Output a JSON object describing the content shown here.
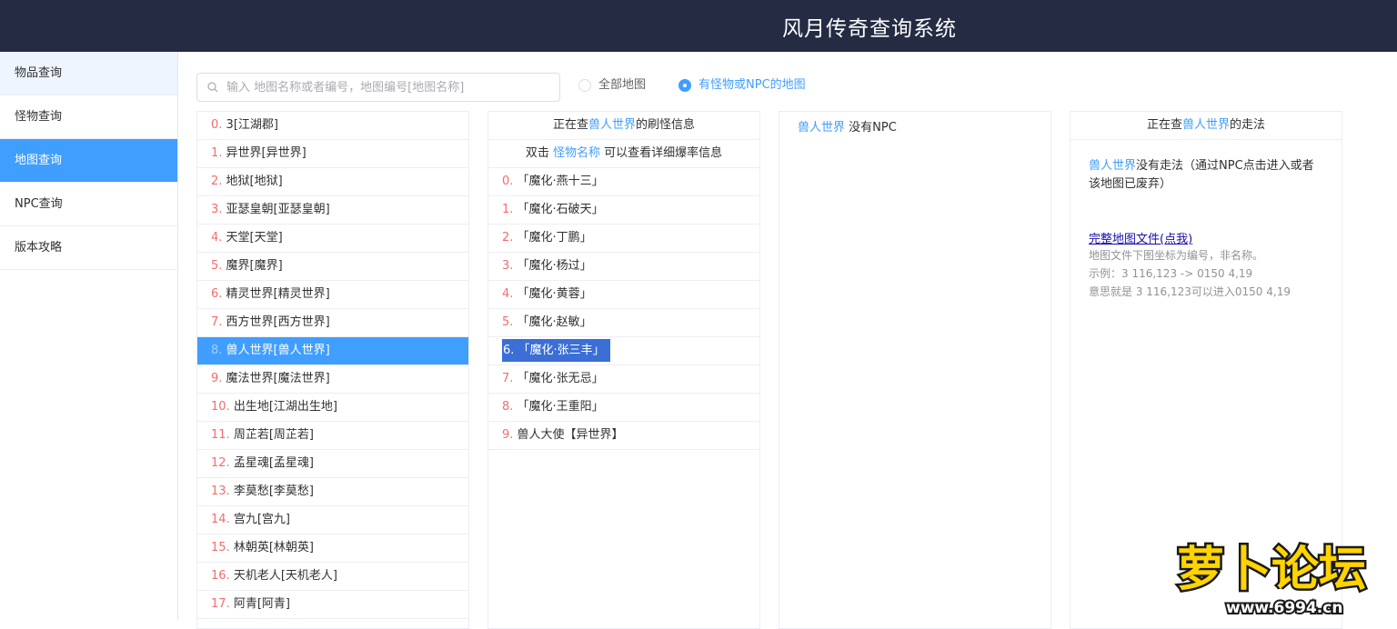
{
  "header": {
    "title": "风月传奇查询系统"
  },
  "sidebar": {
    "items": [
      {
        "label": "物品查询"
      },
      {
        "label": "怪物查询"
      },
      {
        "label": "地图查询"
      },
      {
        "label": "NPC查询"
      },
      {
        "label": "版本攻略"
      }
    ],
    "active_index": 2
  },
  "search": {
    "placeholder": "输入 地图名称或者编号，地图编号[地图名称]",
    "value": ""
  },
  "filters": {
    "all_maps": "全部地图",
    "monster_npc_maps": "有怪物或NPC的地图",
    "selected": "monster_npc_maps"
  },
  "map_list": [
    {
      "idx": "0.",
      "name": "3[江湖郡]"
    },
    {
      "idx": "1.",
      "name": "异世界[异世界]"
    },
    {
      "idx": "2.",
      "name": "地狱[地狱]"
    },
    {
      "idx": "3.",
      "name": "亚瑟皇朝[亚瑟皇朝]"
    },
    {
      "idx": "4.",
      "name": "天堂[天堂]"
    },
    {
      "idx": "5.",
      "name": "魔界[魔界]"
    },
    {
      "idx": "6.",
      "name": "精灵世界[精灵世界]"
    },
    {
      "idx": "7.",
      "name": "西方世界[西方世界]"
    },
    {
      "idx": "8.",
      "name": "兽人世界[兽人世界]"
    },
    {
      "idx": "9.",
      "name": "魔法世界[魔法世界]"
    },
    {
      "idx": "10.",
      "name": "出生地[江湖出生地]"
    },
    {
      "idx": "11.",
      "name": "周芷若[周芷若]"
    },
    {
      "idx": "12.",
      "name": "孟星魂[孟星魂]"
    },
    {
      "idx": "13.",
      "name": "李莫愁[李莫愁]"
    },
    {
      "idx": "14.",
      "name": "宫九[宫九]"
    },
    {
      "idx": "15.",
      "name": "林朝英[林朝英]"
    },
    {
      "idx": "16.",
      "name": "天机老人[天机老人]"
    },
    {
      "idx": "17.",
      "name": "阿青[阿青]"
    }
  ],
  "map_selected_index": 8,
  "spawn_panel": {
    "header_prefix": "正在查",
    "map_name": "兽人世界",
    "header_suffix": "的刷怪信息",
    "hint_prefix": "双击",
    "hint_link": "怪物名称",
    "hint_suffix": "可以查看详细爆率信息",
    "monsters": [
      {
        "idx": "0.",
        "name": "「魔化·燕十三」"
      },
      {
        "idx": "1.",
        "name": "「魔化·石破天」"
      },
      {
        "idx": "2.",
        "name": "「魔化·丁鹏」"
      },
      {
        "idx": "3.",
        "name": "「魔化·杨过」"
      },
      {
        "idx": "4.",
        "name": "「魔化·黄蓉」"
      },
      {
        "idx": "5.",
        "name": "「魔化·赵敏」"
      },
      {
        "idx": "6.",
        "name": "「魔化·张三丰」"
      },
      {
        "idx": "7.",
        "name": "「魔化·张无忌」"
      },
      {
        "idx": "8.",
        "name": "「魔化·王重阳」"
      },
      {
        "idx": "9.",
        "name": "兽人大使【异世界】"
      }
    ],
    "selected_index": 6
  },
  "npc_panel": {
    "map_name": "兽人世界",
    "text": "没有NPC"
  },
  "route_panel": {
    "header_prefix": "正在查",
    "map_name": "兽人世界",
    "header_suffix": "的走法",
    "info_map": "兽人世界",
    "info_text": "没有走法（通过NPC点击进入或者该地图已废弃）",
    "link": "完整地图文件(点我)",
    "note_lines": [
      "地图文件下图坐标为编号，非名称。",
      "示例：3 116,123 -> 0150 4,19",
      "意思就是 3 116,123可以进入0150 4,19"
    ]
  },
  "watermark": {
    "text": "萝卜论坛",
    "url": "www.6994.cn"
  },
  "colors": {
    "header_bg": "#242b43",
    "accent": "#409eff",
    "index_red": "#f56c6c"
  }
}
